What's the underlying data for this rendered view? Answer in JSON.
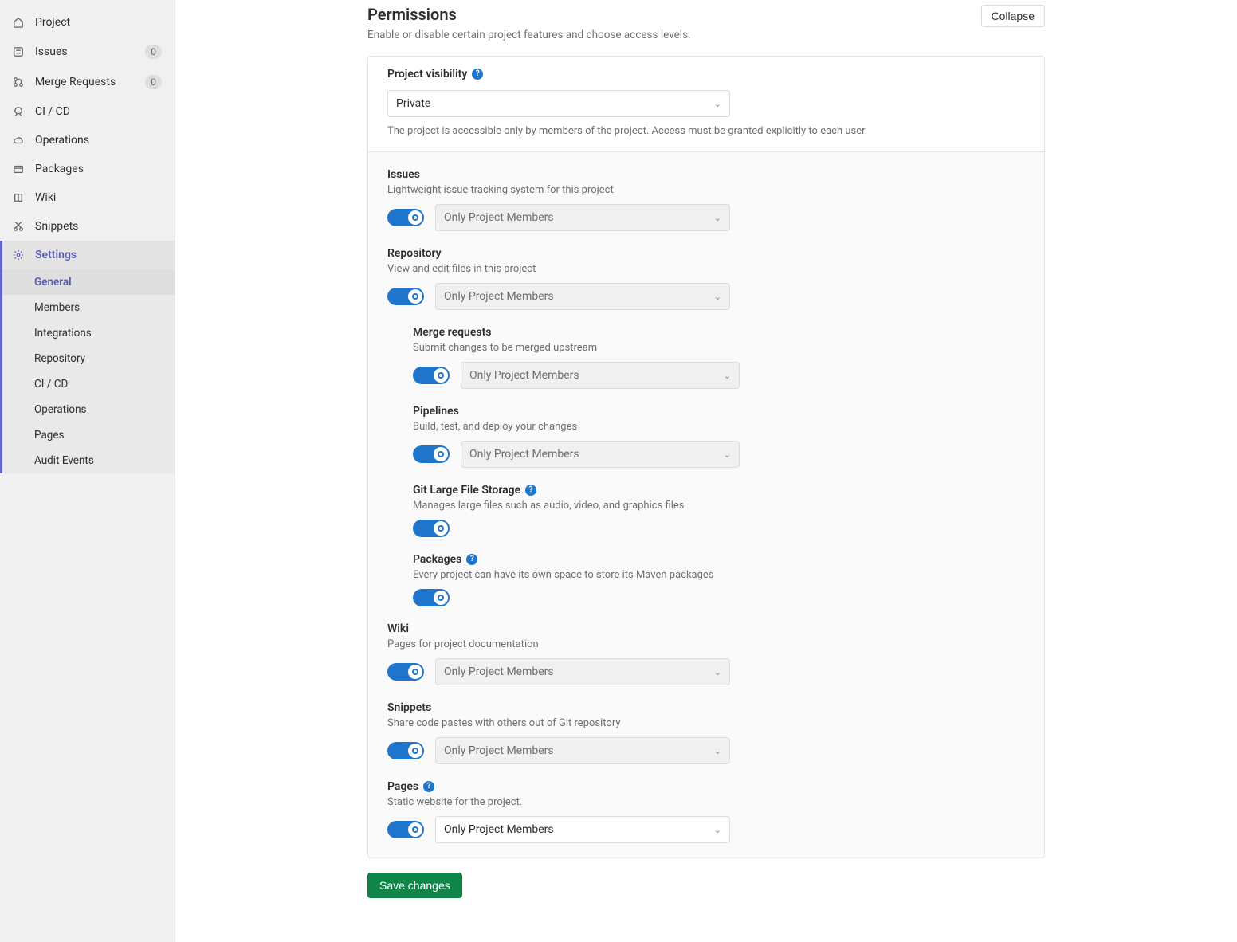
{
  "sidebar": {
    "items": [
      {
        "label": "Project",
        "icon": "home",
        "badge": null
      },
      {
        "label": "Issues",
        "icon": "issues",
        "badge": "0"
      },
      {
        "label": "Merge Requests",
        "icon": "merge",
        "badge": "0"
      },
      {
        "label": "CI / CD",
        "icon": "rocket",
        "badge": null
      },
      {
        "label": "Operations",
        "icon": "cloud",
        "badge": null
      },
      {
        "label": "Packages",
        "icon": "package",
        "badge": null
      },
      {
        "label": "Wiki",
        "icon": "book",
        "badge": null
      },
      {
        "label": "Snippets",
        "icon": "snippets",
        "badge": null
      },
      {
        "label": "Settings",
        "icon": "gear",
        "badge": null
      }
    ],
    "sub_items": [
      {
        "label": "General"
      },
      {
        "label": "Members"
      },
      {
        "label": "Integrations"
      },
      {
        "label": "Repository"
      },
      {
        "label": "CI / CD"
      },
      {
        "label": "Operations"
      },
      {
        "label": "Pages"
      },
      {
        "label": "Audit Events"
      }
    ]
  },
  "header": {
    "title": "Permissions",
    "subtitle": "Enable or disable certain project features and choose access levels.",
    "collapse": "Collapse"
  },
  "visibility": {
    "title": "Project visibility",
    "value": "Private",
    "desc": "The project is accessible only by members of the project. Access must be granted explicitly to each user."
  },
  "features": {
    "issues": {
      "title": "Issues",
      "desc": "Lightweight issue tracking system for this project",
      "value": "Only Project Members"
    },
    "repository": {
      "title": "Repository",
      "desc": "View and edit files in this project",
      "value": "Only Project Members"
    },
    "mr": {
      "title": "Merge requests",
      "desc": "Submit changes to be merged upstream",
      "value": "Only Project Members"
    },
    "pipelines": {
      "title": "Pipelines",
      "desc": "Build, test, and deploy your changes",
      "value": "Only Project Members"
    },
    "lfs": {
      "title": "Git Large File Storage",
      "desc": "Manages large files such as audio, video, and graphics files"
    },
    "packages": {
      "title": "Packages",
      "desc": "Every project can have its own space to store its Maven packages"
    },
    "wiki": {
      "title": "Wiki",
      "desc": "Pages for project documentation",
      "value": "Only Project Members"
    },
    "snippets": {
      "title": "Snippets",
      "desc": "Share code pastes with others out of Git repository",
      "value": "Only Project Members"
    },
    "pages": {
      "title": "Pages",
      "desc": "Static website for the project.",
      "value": "Only Project Members"
    }
  },
  "save": "Save changes"
}
